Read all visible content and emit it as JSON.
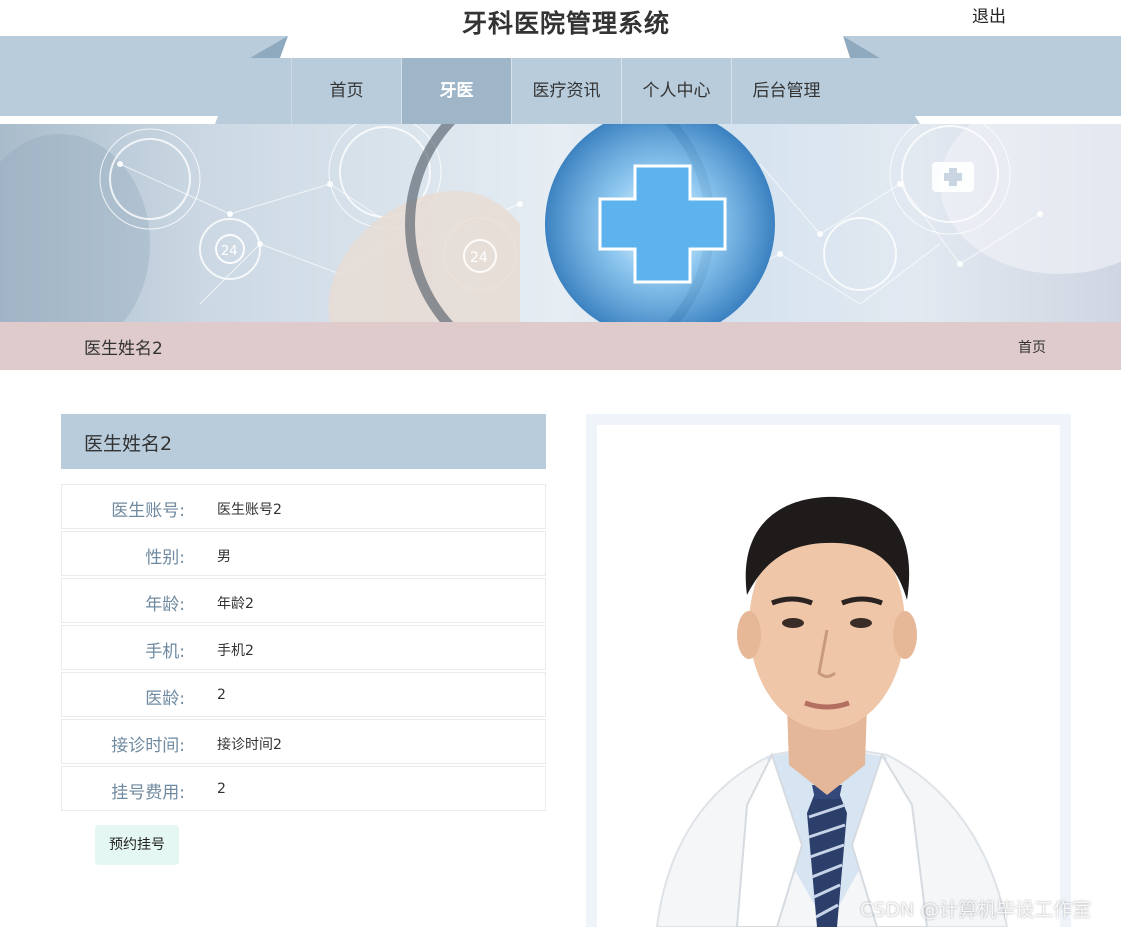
{
  "header": {
    "site_title": "牙科医院管理系统",
    "logout_label": "退出"
  },
  "nav": {
    "items": [
      {
        "label": "首页"
      },
      {
        "label": "牙医"
      },
      {
        "label": "医疗资讯"
      },
      {
        "label": "个人中心"
      },
      {
        "label": "后台管理"
      }
    ],
    "active": "牙医"
  },
  "breadcrumb": {
    "title": "医生姓名2",
    "home_label": "首页"
  },
  "doctor": {
    "name": "医生姓名2",
    "fields": [
      {
        "label": "医生账号:",
        "value": "医生账号2"
      },
      {
        "label": "性别:",
        "value": "男"
      },
      {
        "label": "年龄:",
        "value": "年龄2"
      },
      {
        "label": "手机:",
        "value": "手机2"
      },
      {
        "label": "医龄:",
        "value": "2"
      },
      {
        "label": "接诊时间:",
        "value": "接诊时间2"
      },
      {
        "label": "挂号费用:",
        "value": "2"
      }
    ],
    "book_label": "预约挂号"
  },
  "watermark": "CSDN @计算机毕设工作室",
  "colors": {
    "nav_band": "#b8ccdc",
    "nav_active": "#9fb6c9",
    "breadcrumb_bg": "#dfcbcb",
    "info_header": "#b8ccdc",
    "label_text": "#6f8aa0",
    "book_button": "#e5f7f2"
  }
}
